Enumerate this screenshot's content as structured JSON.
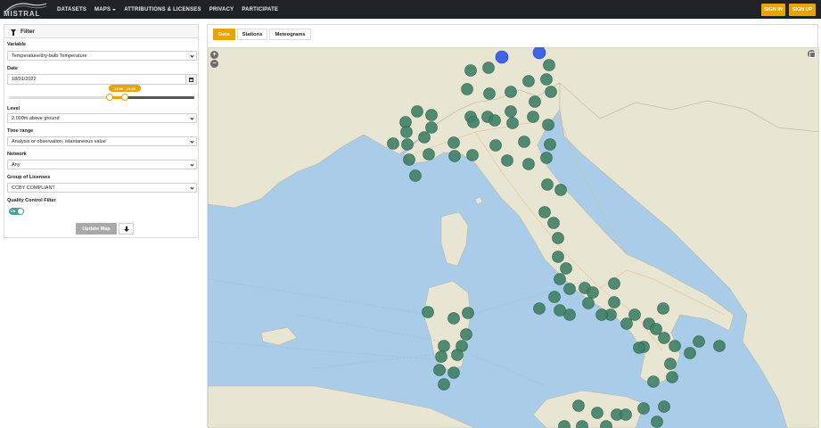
{
  "nav": {
    "logo": "MISTRAL",
    "links": [
      {
        "label": "DATASETS",
        "dropdown": false
      },
      {
        "label": "MAPS",
        "dropdown": true
      },
      {
        "label": "ATTRIBUTIONS & LICENSES",
        "dropdown": false
      },
      {
        "label": "PRIVACY",
        "dropdown": false
      },
      {
        "label": "PARTICIPATE",
        "dropdown": false
      }
    ],
    "sign_in": "SIGN IN",
    "sign_up": "SIGN UP"
  },
  "filter": {
    "title": "Filter",
    "variable_label": "Variable",
    "variable_value": "Temperature/dry-bulb Temperature",
    "date_label": "Date",
    "date_value": "18/01/2022",
    "time_range_tooltip": "13:00 - 15:00",
    "slider_min_fraction": 0.5417,
    "slider_max_fraction": 0.625,
    "level_label": "Level",
    "level_value": "2,000m above ground",
    "timerange_label": "Time range",
    "timerange_value": "Analysis or observation, istantaneous value",
    "network_label": "Network",
    "network_value": "Any",
    "license_label": "Group of Licenses",
    "license_value": "CCBY COMPLIANT",
    "qc_label": "Quality Control Filter",
    "qc_toggle_text": "ON",
    "qc_enabled": true,
    "update_button": "Update Map"
  },
  "tabs": [
    {
      "label": "Data",
      "active": true
    },
    {
      "label": "Stations",
      "active": false
    },
    {
      "label": "Meteograms",
      "active": false
    }
  ],
  "map": {
    "zoom_in": "+",
    "zoom_out": "−",
    "colors": {
      "sea": "#a9cde8",
      "land": "#e8e5d2",
      "marker": "#3f8066",
      "marker_blue": "#2f55e8",
      "accent": "#e9a400"
    }
  }
}
